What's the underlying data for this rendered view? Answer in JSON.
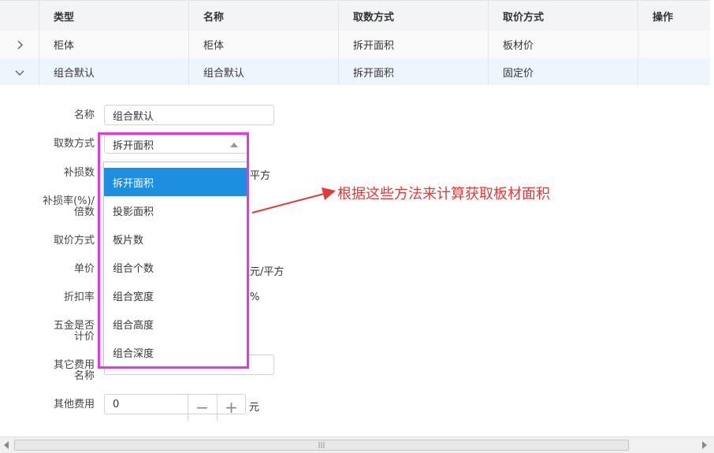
{
  "table": {
    "headers": [
      "类型",
      "名称",
      "取数方式",
      "取价方式",
      "操作"
    ],
    "rows": [
      {
        "type": "柜体",
        "name": "柜体",
        "fetch": "拆开面积",
        "price": "板材价"
      },
      {
        "type": "组合默认",
        "name": "组合默认",
        "fetch": "拆开面积",
        "price": "固定价"
      }
    ]
  },
  "form": {
    "name_label": "名称",
    "name_value": "组合默认",
    "fetch_label": "取数方式",
    "fetch_value": "拆开面积",
    "loss_label": "补损数",
    "loss_unit": "平方",
    "loss_rate_label_1": "补损率(%)/",
    "loss_rate_label_2": "倍数",
    "price_label": "取价方式",
    "unit_price_label": "单价",
    "unit_price_unit": "元/平方",
    "discount_label": "折扣率",
    "discount_unit": "%",
    "hardware_label_1": "五金是否",
    "hardware_label_2": "计价",
    "other_name_label_1": "其它费用",
    "other_name_label_2": "名称",
    "other_fee_label": "其他费用",
    "other_fee_value": "0",
    "other_fee_unit": "元",
    "minus": "−",
    "plus": "+"
  },
  "dropdown": {
    "options": [
      "拆开面积",
      "投影面积",
      "板片数",
      "组合个数",
      "组合宽度",
      "组合高度",
      "组合深度"
    ],
    "selected_index": 0
  },
  "annotation": {
    "text": "根据这些方法来计算获取板材面积",
    "color": "#e53935"
  },
  "colors": {
    "accent": "#1e8fe0",
    "highlight": "#e13ae0"
  }
}
